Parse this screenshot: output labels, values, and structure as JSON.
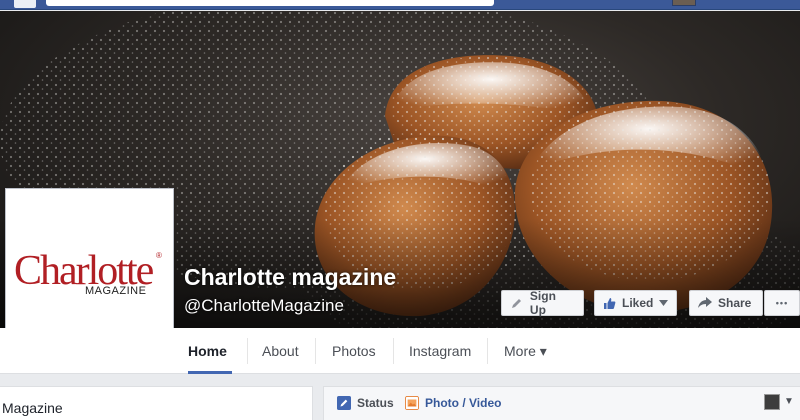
{
  "page": {
    "name": "Charlotte magazine",
    "handle": "@CharlotteMagazine",
    "logo_text": "Charlotte",
    "logo_subtext": "MAGAZINE",
    "logo_mark": "®"
  },
  "actions": {
    "signup_label": "Sign Up",
    "liked_label": "Liked",
    "share_label": "Share",
    "more_label": "•••"
  },
  "tabs": [
    {
      "label": "Home"
    },
    {
      "label": "About"
    },
    {
      "label": "Photos"
    },
    {
      "label": "Instagram"
    },
    {
      "label": "More ▾"
    }
  ],
  "sidebar": {
    "card_label": "Magazine"
  },
  "composer": {
    "status_label": "Status",
    "photo_label": "Photo / Video",
    "caret": "▼"
  },
  "colors": {
    "brand_blue": "#3b5998",
    "accent_blue": "#4267b2",
    "logo_red": "#b11f24"
  },
  "icons": [
    "pencil-icon",
    "thumbs-up-icon",
    "share-arrow-icon",
    "edit-icon",
    "photo-icon"
  ]
}
